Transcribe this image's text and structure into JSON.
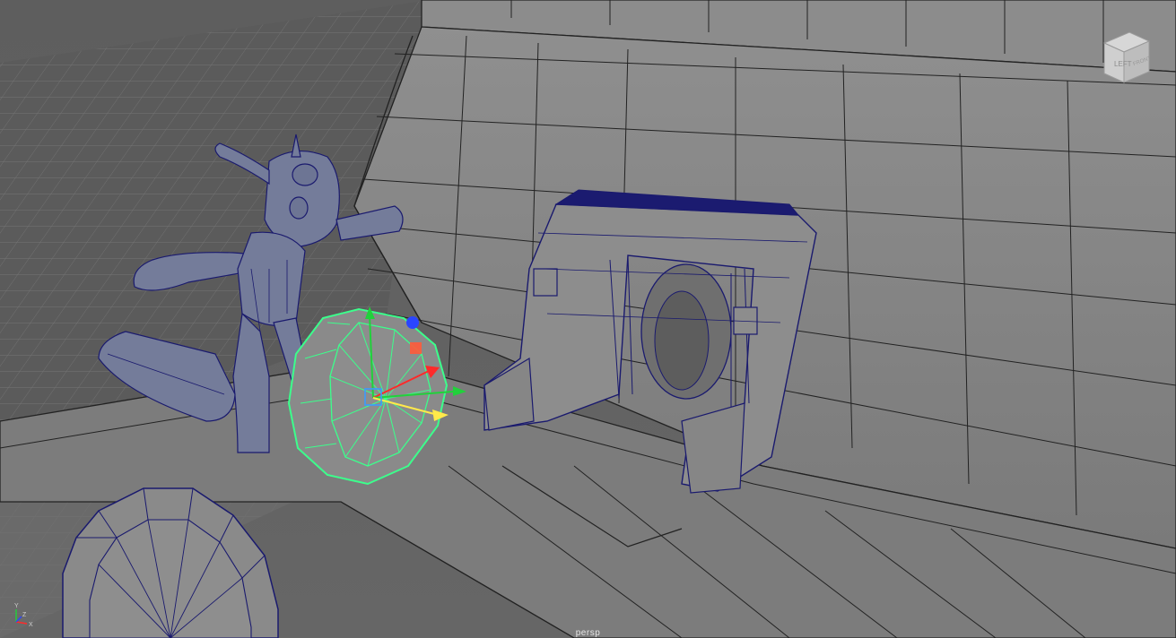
{
  "viewport": {
    "camera_label": "persp",
    "viewcube_face": "LEFT",
    "viewcube_face_2": "FRONT",
    "axis_labels": [
      "Y",
      "Z",
      "X"
    ]
  },
  "scene": {
    "wireframe_color": "#1a1a6e",
    "selection_color": "#3cff8c",
    "surface_color": "#8a8a8a",
    "grid_color": "#6e6e6e"
  },
  "manipulator": {
    "x_color": "#ff2a2a",
    "y_color": "#21d13b",
    "z_color": "#2a45ff",
    "center_color": "#3a9cff",
    "extra_color": "#ffe94a"
  },
  "icons": [
    "viewcube-icon",
    "axis-indicator-icon",
    "move-manipulator-icon"
  ]
}
